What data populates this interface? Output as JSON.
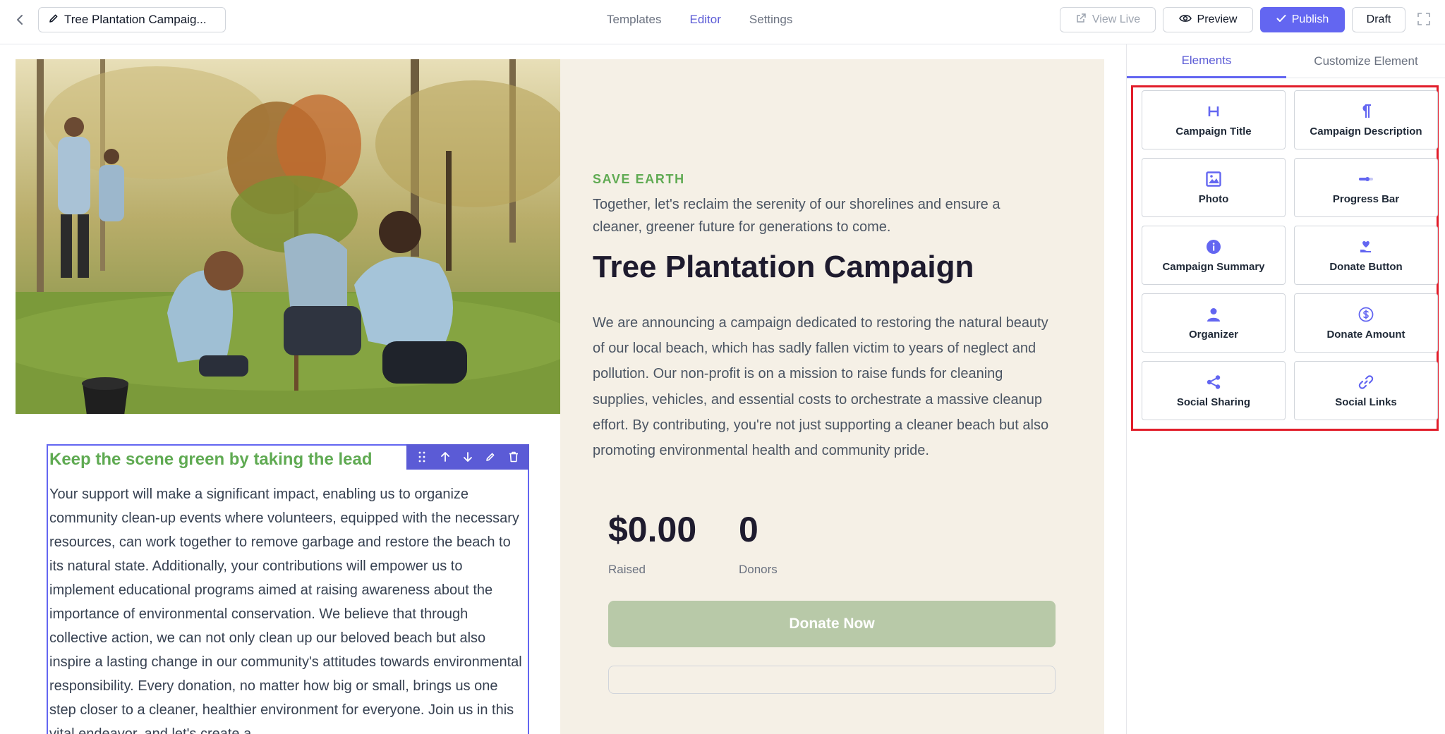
{
  "header": {
    "campaign_title": "Tree Plantation Campaig...",
    "tabs": [
      {
        "label": "Templates"
      },
      {
        "label": "Editor"
      },
      {
        "label": "Settings"
      }
    ],
    "view_live_label": "View Live",
    "preview_label": "Preview",
    "publish_label": "Publish",
    "draft_label": "Draft"
  },
  "campaign": {
    "kicker": "SAVE EARTH",
    "subtitle": "Together, let's reclaim the serenity of our shorelines and ensure a cleaner, greener future for generations to come.",
    "title": "Tree Plantation Campaign",
    "description": "We are announcing a campaign dedicated to restoring the natural beauty of our local beach, which has sadly fallen victim to years of neglect and pollution. Our non-profit is on a mission to raise funds for cleaning supplies, vehicles, and essential costs to orchestrate a massive cleanup effort. By contributing, you're not just supporting a cleaner beach but also promoting environmental health and community pride.",
    "raised_value": "$0.00",
    "raised_label": "Raised",
    "donors_value": "0",
    "donors_label": "Donors",
    "donate_label": "Donate Now"
  },
  "block": {
    "heading": "Keep the scene green by taking the lead",
    "text": "Your support will make a significant impact, enabling us to organize community clean-up events where volunteers, equipped with the necessary resources, can work together to remove garbage and restore the beach to its natural state. Additionally, your contributions will empower us to implement educational programs aimed at raising awareness about the importance of environmental conservation. We believe that through collective action, we can not only clean up our beloved beach but also inspire a lasting change in our community's attitudes towards environmental responsibility. Every donation, no matter how big or small, brings us one step closer to a cleaner, healthier environment for everyone. Join us in this vital endeavor, and let's create a"
  },
  "sidebar": {
    "tabs": [
      {
        "label": "Elements"
      },
      {
        "label": "Customize Element"
      }
    ],
    "elements": [
      {
        "label": "Campaign Title",
        "icon": "heading-icon"
      },
      {
        "label": "Campaign Description",
        "icon": "paragraph-icon"
      },
      {
        "label": "Photo",
        "icon": "photo-icon"
      },
      {
        "label": "Progress Bar",
        "icon": "progress-bar-icon"
      },
      {
        "label": "Campaign Summary",
        "icon": "info-icon"
      },
      {
        "label": "Donate Button",
        "icon": "donate-hand-icon"
      },
      {
        "label": "Organizer",
        "icon": "user-icon"
      },
      {
        "label": "Donate Amount",
        "icon": "dollar-icon"
      },
      {
        "label": "Social Sharing",
        "icon": "share-icon"
      },
      {
        "label": "Social Links",
        "icon": "link-icon"
      }
    ]
  },
  "colors": {
    "accent": "#6366f1",
    "green": "#5faa52",
    "panel_bg": "#f5f0e6",
    "highlight": "#e11d2a"
  }
}
